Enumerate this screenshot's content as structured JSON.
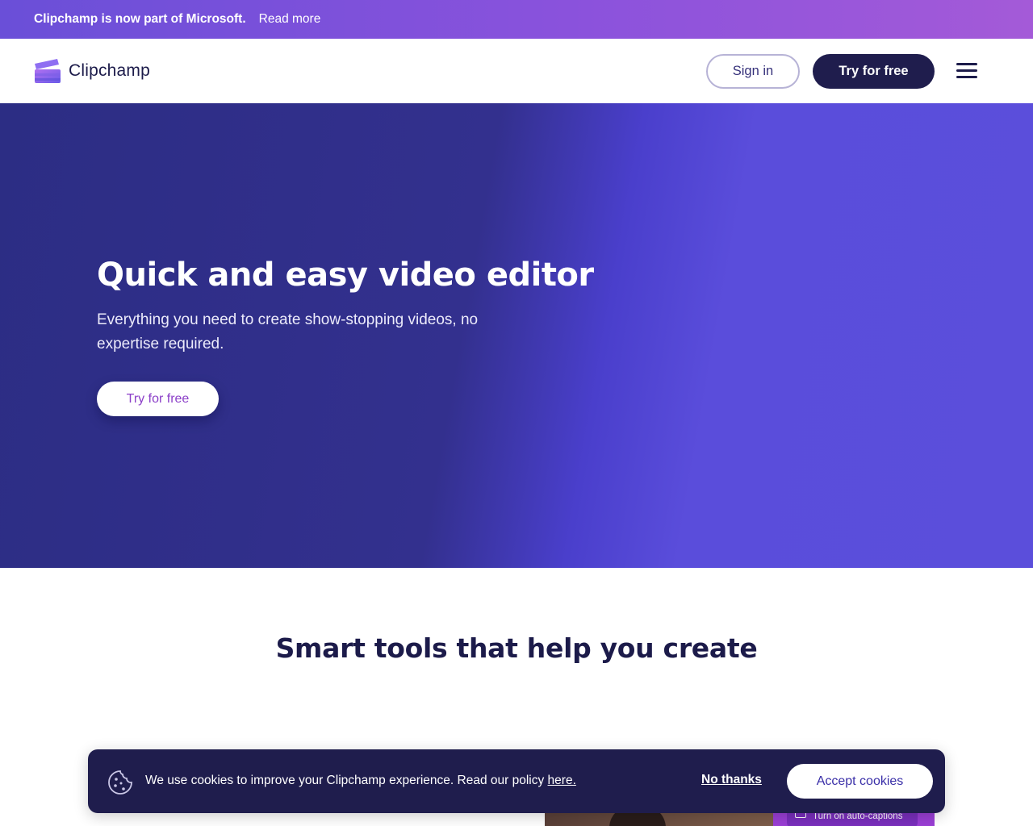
{
  "announcement": {
    "message": "Clipchamp is now part of Microsoft.",
    "link_label": "Read more"
  },
  "nav": {
    "brand": "Clipchamp",
    "sign_in_label": "Sign in",
    "try_free_label": "Try for free",
    "menu_icon": "hamburger-menu-icon"
  },
  "hero": {
    "title": "Quick and easy video editor",
    "subtitle": "Everything you need to create show-stopping videos, no expertise required.",
    "cta_label": "Try for free"
  },
  "tools_section": {
    "title": "Smart tools that help you create",
    "preview_badge": "Turn on auto-captions"
  },
  "cookie_banner": {
    "icon": "cookie-icon",
    "text": "We use cookies to improve your Clipchamp experience. Read our policy ",
    "link_label": "here.",
    "no_thanks_label": "No thanks",
    "accept_label": "Accept cookies"
  },
  "colors": {
    "brand_dark": "#1f1d4d",
    "hero_start": "#2c2d84",
    "hero_end": "#5b4edb",
    "cta_text": "#8b3fc8"
  }
}
